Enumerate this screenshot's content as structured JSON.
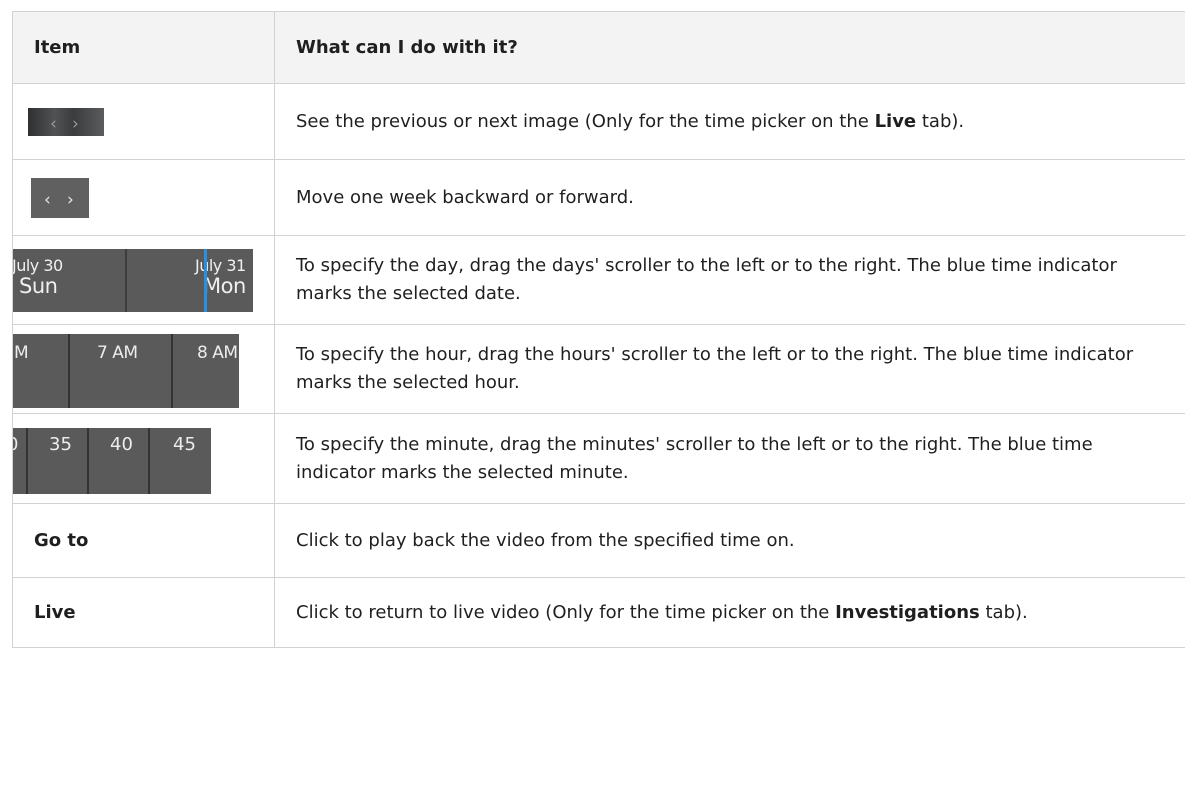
{
  "table": {
    "headers": [
      "Item",
      "What can I do with it?"
    ],
    "rows": [
      {
        "item_icon": "prev-next-image-arrows-icon",
        "item_glyphs": {
          "prev": "‹",
          "next": "›"
        },
        "desc_before": "See the previous or next image (Only for the time picker on the ",
        "desc_bold": "Live",
        "desc_after": " tab)."
      },
      {
        "item_icon": "week-backward-forward-arrows-icon",
        "item_glyphs": {
          "prev": "‹",
          "next": "›"
        },
        "desc": "Move one week backward or forward."
      },
      {
        "item_icon": "days-scroller",
        "days": [
          {
            "month_day": "July 30",
            "weekday": "Sun"
          },
          {
            "month_day": "July 31",
            "weekday": "Mon"
          }
        ],
        "desc": "To specify the day, drag the days' scroller to the left or to the right. The blue time indicator marks the selected date."
      },
      {
        "item_icon": "hours-scroller",
        "hours": [
          "M",
          "7 AM",
          "8 AM"
        ],
        "desc": "To specify the hour, drag the hours' scroller to the left or to the right. The blue time indicator marks the selected hour."
      },
      {
        "item_icon": "minutes-scroller",
        "minutes": [
          "0",
          "35",
          "40",
          "45"
        ],
        "desc": "To specify the minute, drag the minutes' scroller to the left or to the right. The blue time indicator marks the selected minute."
      },
      {
        "item_text": "Go to",
        "desc": "Click to play back the video from the specified time on."
      },
      {
        "item_text": "Live",
        "desc_before": "Click to return to live video (Only for the time picker on the ",
        "desc_bold": "Investigations",
        "desc_after": " tab)."
      }
    ]
  },
  "colors": {
    "header_bg": "#f3f3f3",
    "border": "#d2d2d2",
    "widget_bg": "#5a5a5a",
    "time_indicator": "#2c8fe0"
  }
}
